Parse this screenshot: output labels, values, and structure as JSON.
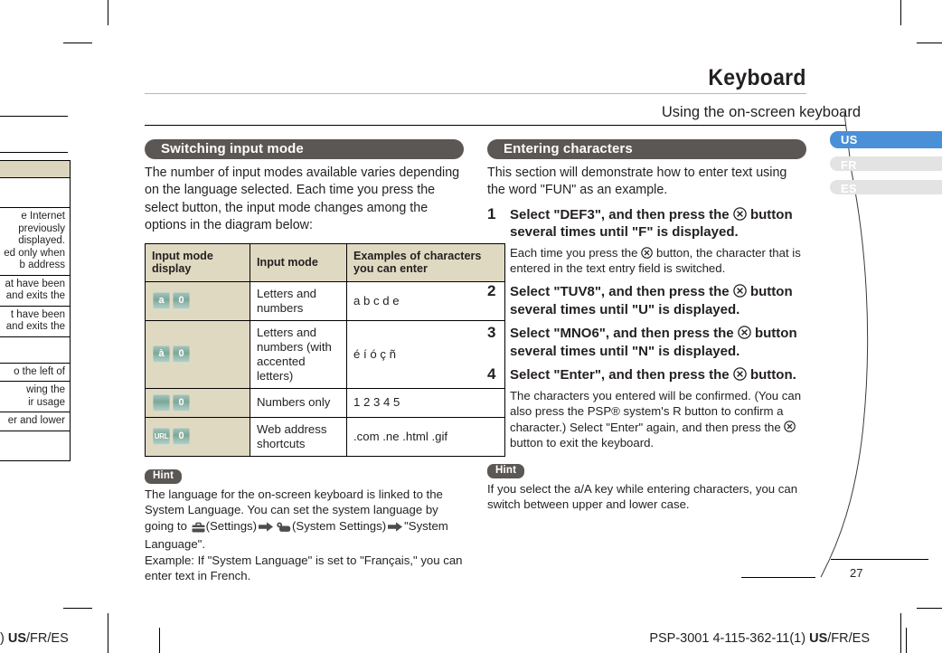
{
  "header": {
    "title": "Keyboard",
    "subtitle": "Using the on-screen keyboard"
  },
  "language_tabs": [
    {
      "label": "US",
      "active": true,
      "color": "#4a90d9"
    },
    {
      "label": "FR",
      "active": false,
      "color": "#e3e3e3"
    },
    {
      "label": "ES",
      "active": false,
      "color": "#e3e3e3"
    }
  ],
  "left_column": {
    "section_title": "Switching input mode",
    "intro": "The number of input modes available varies depending on the language selected. Each time you press the select button, the input mode changes among the options in the diagram below:",
    "table": {
      "headers": [
        "Input mode display",
        "Input mode",
        "Examples of characters you can enter"
      ],
      "rows": [
        {
          "chips": [
            "a",
            "0"
          ],
          "mode": "Letters and numbers",
          "examples": "a b c d e"
        },
        {
          "chips": [
            "à",
            "0"
          ],
          "mode": "Letters and numbers (with accented letters)",
          "examples": "é í ó ç ñ"
        },
        {
          "chips": [
            "",
            "0"
          ],
          "mode": "Numbers only",
          "examples": "1 2 3 4 5"
        },
        {
          "chips": [
            "URL",
            "0"
          ],
          "mode": "Web address shortcuts",
          "examples": ".com .ne .html .gif"
        }
      ]
    },
    "hint": {
      "label": "Hint",
      "line1_a": "The language for the on-screen keyboard is linked to the System Language. You can set the system language by going to ",
      "settings_label": "(Settings)",
      "system_settings_label": "(System Settings)",
      "line1_b": "\"System Language\".",
      "line2": "Example:  If \"System Language\" is set to \"Français,\" you can enter text in French."
    }
  },
  "right_column": {
    "section_title": "Entering characters",
    "intro": "This section will demonstrate how to enter text using the word \"FUN\" as an example.",
    "steps": [
      {
        "num": "1",
        "title_a": "Select \"DEF3\", and then press the ",
        "title_b": " button several times until \"F\" is displayed.",
        "desc_a": "Each time you press the ",
        "desc_b": " button, the character that is entered in the text entry field is switched."
      },
      {
        "num": "2",
        "title_a": "Select \"TUV8\", and then press the ",
        "title_b": " button several times until \"U\" is displayed.",
        "desc_a": "",
        "desc_b": ""
      },
      {
        "num": "3",
        "title_a": "Select \"MNO6\", and then press the ",
        "title_b": " button several times until \"N\" is displayed.",
        "desc_a": "",
        "desc_b": ""
      },
      {
        "num": "4",
        "title_a": "Select \"Enter\", and then press the ",
        "title_b": " button.",
        "desc_a": "The characters you entered will be confirmed. (You can also press the PSP® system's R button to confirm a character.) Select \"Enter\" again, and then press the ",
        "desc_b": " button to exit the keyboard."
      }
    ],
    "hint": {
      "label": "Hint",
      "text": "If you select the a/A key while entering characters, you can switch between upper and lower case."
    }
  },
  "bleed_table_rows": [
    "",
    "e Internet\npreviously\ndisplayed.\ned only when\nb address",
    "at have been\nand exits the",
    "t have been\nand exits the",
    "",
    "o the left of",
    "wing the\nir usage",
    "er and lower",
    ""
  ],
  "page_number": "27",
  "footer": {
    "left": ") US/FR/ES",
    "left_bold": "US",
    "right_plain": "PSP-3001 4-115-362-11(1) ",
    "right_bold": "US",
    "right_tail": "/FR/ES"
  }
}
